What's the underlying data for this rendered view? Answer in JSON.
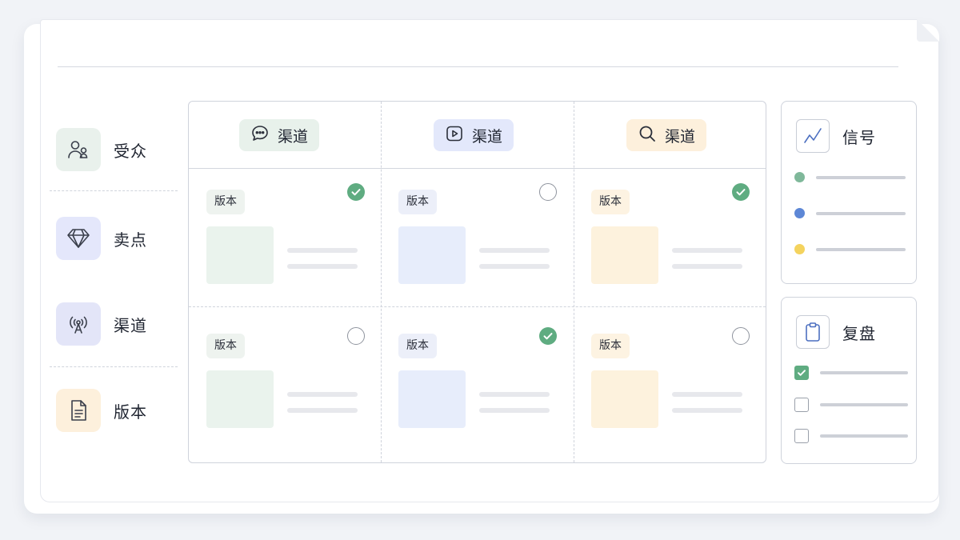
{
  "legend": [
    {
      "label": "受众",
      "icon": "users-icon",
      "bg": "#e9f1ec"
    },
    {
      "label": "卖点",
      "icon": "diamond-icon",
      "bg": "#e4e7fb"
    },
    {
      "label": "渠道",
      "icon": "broadcast-icon",
      "bg": "#e3e5f8"
    },
    {
      "label": "版本",
      "icon": "document-icon",
      "bg": "#fdf0dc"
    }
  ],
  "channels": [
    {
      "label": "渠道",
      "icon": "chat-icon",
      "bg": "#e8f1eb"
    },
    {
      "label": "渠道",
      "icon": "video-icon",
      "bg": "#e3e8fb"
    },
    {
      "label": "渠道",
      "icon": "search-icon",
      "bg": "#fdf0dc"
    }
  ],
  "cells": [
    {
      "tag": "版本",
      "checked": true
    },
    {
      "tag": "版本",
      "checked": false
    },
    {
      "tag": "版本",
      "checked": true
    },
    {
      "tag": "版本",
      "checked": false
    },
    {
      "tag": "版本",
      "checked": true
    },
    {
      "tag": "版本",
      "checked": false
    }
  ],
  "column_colors": [
    {
      "tag_bg": "#eef3ef",
      "thumb": "#eaf3ed"
    },
    {
      "tag_bg": "#eceff9",
      "thumb": "#e7edfb"
    },
    {
      "tag_bg": "#fdf3e2",
      "thumb": "#fdf2dd"
    }
  ],
  "signal_panel": {
    "title": "信号",
    "icon": "trend-line-icon",
    "dots": [
      "#7fb89a",
      "#5d87d6",
      "#f4d35e"
    ]
  },
  "review_panel": {
    "title": "复盘",
    "icon": "clipboard-icon",
    "checks": [
      true,
      false,
      false
    ]
  },
  "accent_green": "#5fac81"
}
